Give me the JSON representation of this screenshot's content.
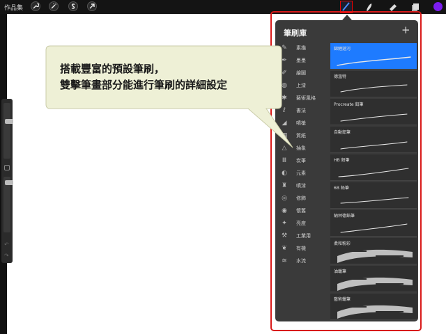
{
  "topbar": {
    "gallery_label": "作品集",
    "left_tools": [
      "wrench-icon",
      "magic-wand-icon",
      "selection-icon",
      "transform-arrow-icon"
    ],
    "right_tools": [
      "brush-icon",
      "smudge-icon",
      "eraser-icon",
      "layers-icon"
    ],
    "active_tool": "brush-icon",
    "current_color": "#7c1df0"
  },
  "panel": {
    "title": "筆刷庫",
    "add_label": "+",
    "categories": [
      {
        "label": "素描",
        "icon": "pencil-icon"
      },
      {
        "label": "墨墨",
        "icon": "ink-drop-icon"
      },
      {
        "label": "繪圖",
        "icon": "drawing-icon"
      },
      {
        "label": "上漆",
        "icon": "paint-icon"
      },
      {
        "label": "藝術風格",
        "icon": "art-icon"
      },
      {
        "label": "書法",
        "icon": "calligraphy-icon"
      },
      {
        "label": "噴槍",
        "icon": "airbrush-icon"
      },
      {
        "label": "質紙",
        "icon": "texture-icon"
      },
      {
        "label": "抽象",
        "icon": "triangle-icon"
      },
      {
        "label": "炭筆",
        "icon": "charcoal-icon"
      },
      {
        "label": "元素",
        "icon": "element-icon"
      },
      {
        "label": "噴漆",
        "icon": "spray-can-icon"
      },
      {
        "label": "修飾",
        "icon": "touchup-icon"
      },
      {
        "label": "懷舊",
        "icon": "retro-icon"
      },
      {
        "label": "亮度",
        "icon": "sparkle-icon"
      },
      {
        "label": "工業用",
        "icon": "anvil-icon"
      },
      {
        "label": "有機",
        "icon": "leaf-icon"
      },
      {
        "label": "水流",
        "icon": "water-icon"
      }
    ],
    "brushes": [
      {
        "name": "錦鯉遊河",
        "selected": true
      },
      {
        "name": "德溫特",
        "selected": false
      },
      {
        "name": "Procreate 鉛筆",
        "selected": false
      },
      {
        "name": "自動鉛筆",
        "selected": false
      },
      {
        "name": "HB 鉛筆",
        "selected": false
      },
      {
        "name": "6B 鉛筆",
        "selected": false
      },
      {
        "name": "納林德鉛筆",
        "selected": false
      },
      {
        "name": "柔和粉彩",
        "selected": false
      },
      {
        "name": "油蠟筆",
        "selected": false
      },
      {
        "name": "藝術蠟筆",
        "selected": false
      }
    ]
  },
  "callout": {
    "line1": "搭載豐富的預設筆刷，",
    "line2": "雙擊筆畫部分能進行筆刷的詳細設定"
  },
  "colors": {
    "highlight": "#d91a1a",
    "selected_brush": "#1e7bff",
    "callout_fill": "#eef0d6"
  }
}
